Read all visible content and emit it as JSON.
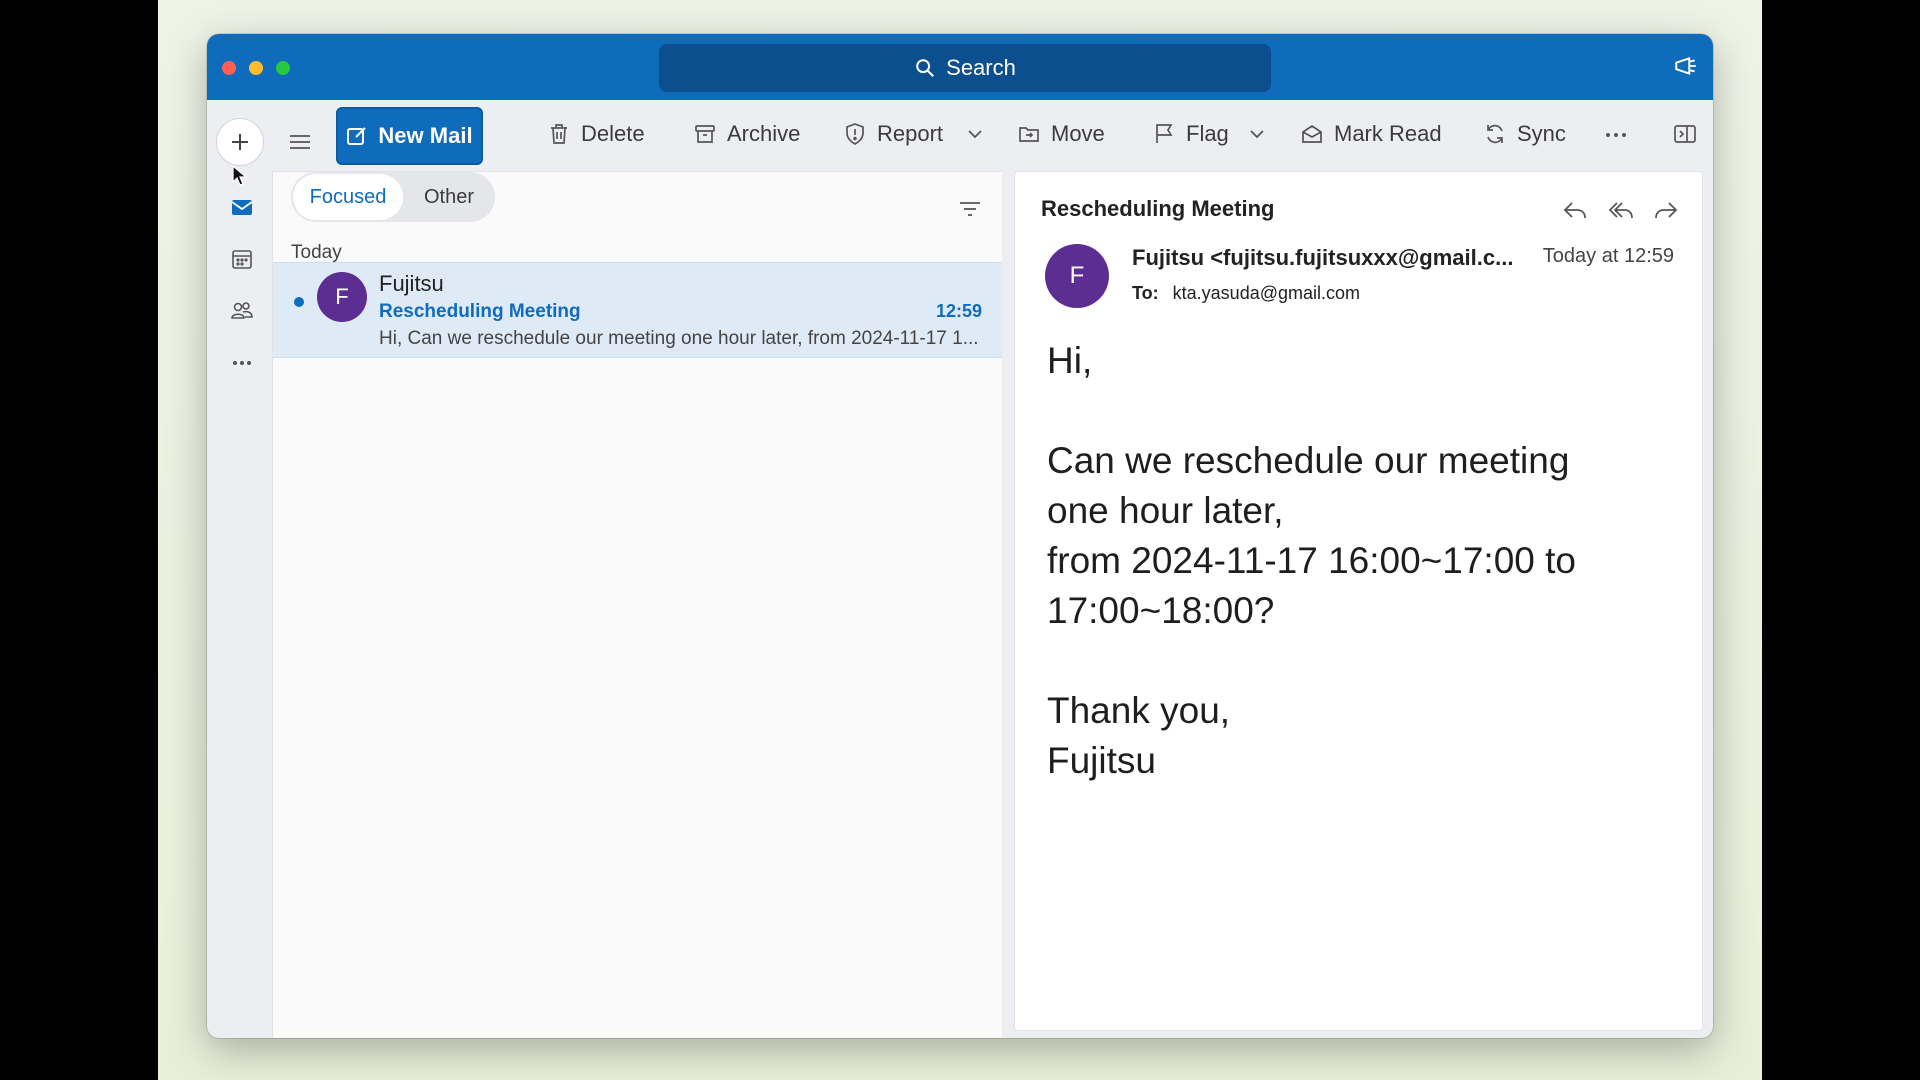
{
  "window": {
    "search_placeholder": "Search"
  },
  "toolbar": {
    "new_mail": "New Mail",
    "delete": "Delete",
    "archive": "Archive",
    "report": "Report",
    "move": "Move",
    "flag": "Flag",
    "mark_read": "Mark Read",
    "sync": "Sync"
  },
  "list": {
    "tabs": [
      "Focused",
      "Other"
    ],
    "group_label": "Today",
    "messages": [
      {
        "avatar_letter": "F",
        "sender": "Fujitsu",
        "subject": "Rescheduling Meeting",
        "time": "12:59",
        "preview": "Hi, Can we reschedule our meeting one hour later, from 2024-11-17 1..."
      }
    ]
  },
  "reading": {
    "subject": "Rescheduling Meeting",
    "avatar_letter": "F",
    "from": "Fujitsu <fujitsu.fujitsuxxx@gmail.c...",
    "date": "Today at 12:59",
    "to_label": "To:",
    "to": "kta.yasuda@gmail.com",
    "body": {
      "greeting": "Hi,",
      "line1": "Can we reschedule our meeting",
      "line2": "one hour later,",
      "line3": "from 2024-11-17 16:00~17:00 to",
      "line4": "17:00~18:00?",
      "closing": "Thank you,",
      "signature": "Fujitsu"
    }
  },
  "colors": {
    "accent": "#0f6cbd",
    "avatar": "#5c2e91",
    "selected_row": "#deebf7"
  }
}
